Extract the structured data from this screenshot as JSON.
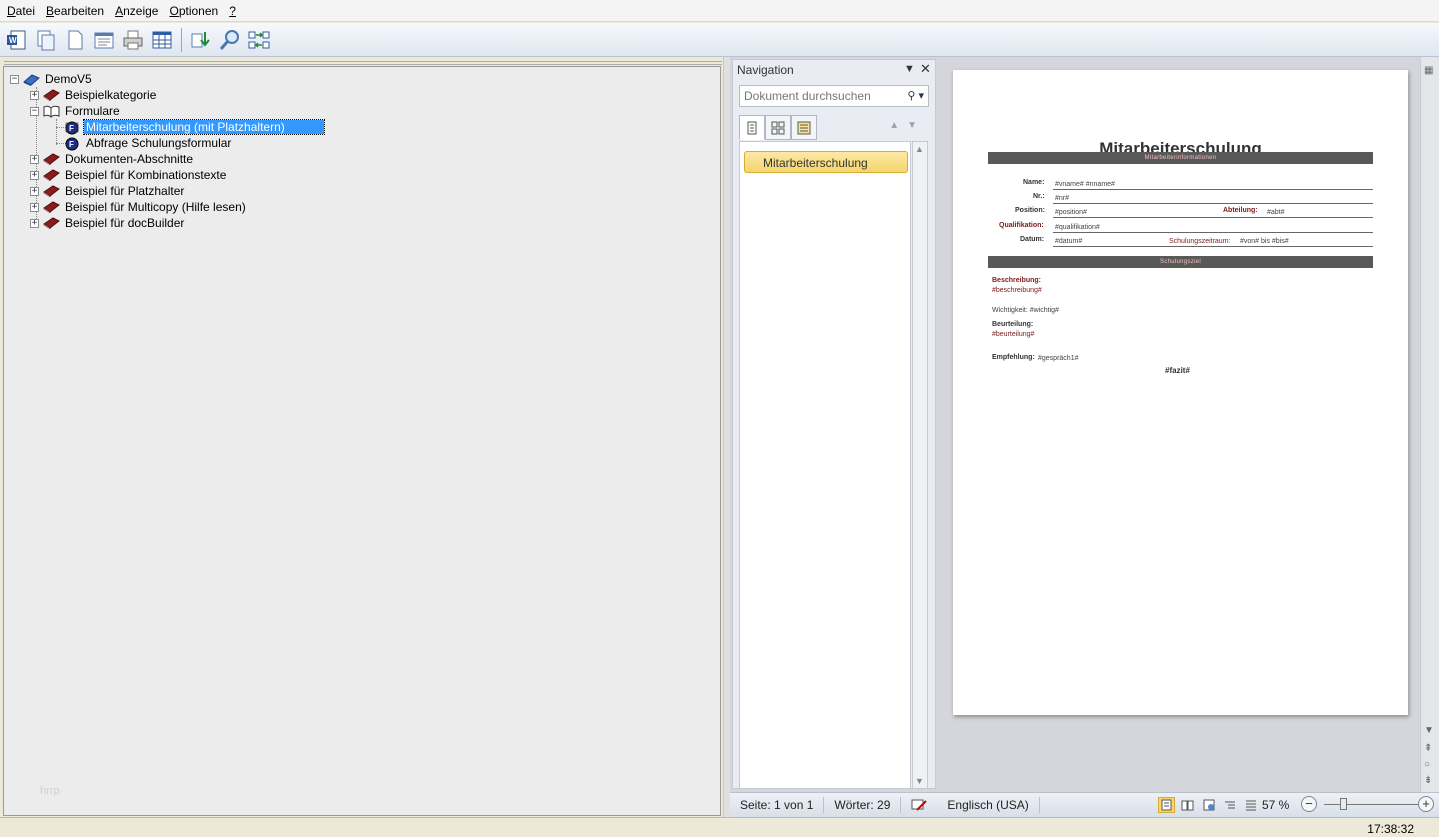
{
  "menu": {
    "items": [
      {
        "label_ul": "D",
        "label_rest": "atei"
      },
      {
        "label_ul": "B",
        "label_rest": "earbeiten"
      },
      {
        "label_ul": "A",
        "label_rest": "nzeige"
      },
      {
        "label_ul": "O",
        "label_rest": "ptionen"
      },
      {
        "label_ul": "?",
        "label_rest": ""
      }
    ]
  },
  "tree": {
    "root": "DemoV5",
    "items": [
      {
        "label": "Beispielkategorie"
      },
      {
        "label": "Formulare"
      },
      {
        "label": "Mitarbeiterschulung (mit Platzhaltern)"
      },
      {
        "label": "Abfrage Schulungsformular"
      },
      {
        "label": "Dokumenten-Abschnitte"
      },
      {
        "label": "Beispiel für Kombinationstexte"
      },
      {
        "label": "Beispiel für Platzhalter"
      },
      {
        "label": "Beispiel für Multicopy (Hilfe lesen)"
      },
      {
        "label": "Beispiel für docBuilder"
      }
    ],
    "watermark": "hrrp"
  },
  "navigation": {
    "title": "Navigation",
    "search_placeholder": "Dokument durchsuchen",
    "heading": "Mitarbeiterschulung"
  },
  "document": {
    "title": "Mitarbeiterschulung",
    "section1": "Mitarbeiterinformationen",
    "name_label": "Name:",
    "name_val": "#vname# #nname#",
    "nr_label": "Nr.:",
    "nr_val": "#nr#",
    "position_label": "Position:",
    "position_val": "#position#",
    "abteilung_label": "Abteilung:",
    "abteilung_val": "#abt#",
    "qualifikation_label": "Qualifikation:",
    "qualifikation_val": "#qualifikation#",
    "datum_label": "Datum:",
    "datum_val": "#datum#",
    "zeitraum_label": "Schulungszeitraum:",
    "zeitraum_val": "#von# bis #bis#",
    "section2": "Schulungsziel",
    "beschreibung_label": "Beschreibung:",
    "beschreibung_val": "#beschreibung#",
    "wichtigkeit": "Wichtigkeit: #wichtig#",
    "beurteilung_label": "Beurteilung:",
    "beurteilung_val": "#beurteilung#",
    "empfehlung_label": "Empfehlung:",
    "empfehlung_val": "#gespräch1#",
    "fazit": "#fazit#"
  },
  "word_status": {
    "page": "Seite: 1 von 1",
    "words": "Wörter: 29",
    "language": "Englisch (USA)",
    "zoom": "57 %",
    "zoom_fraction": 0.57
  },
  "status": {
    "clock": "17:38:32"
  },
  "colors": {
    "selection": "#3399ff",
    "nav_heading": "#f6d56b",
    "doc_bar": "#595959"
  }
}
